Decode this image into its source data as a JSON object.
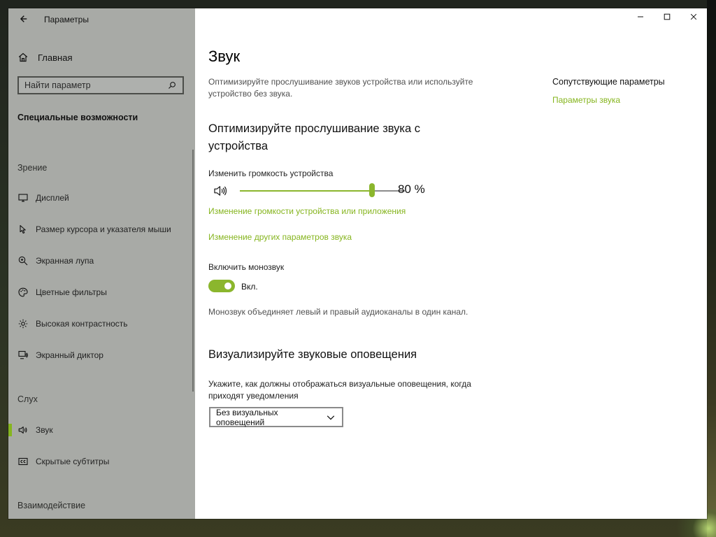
{
  "window": {
    "app_title": "Параметры",
    "controls": {
      "minimize_icon": "minimize-icon",
      "maximize_icon": "maximize-icon",
      "close_icon": "close-icon"
    }
  },
  "sidebar": {
    "back_icon": "back-arrow-icon",
    "home": {
      "label": "Главная",
      "icon": "home-icon"
    },
    "search": {
      "placeholder": "Найти параметр",
      "icon": "search-icon"
    },
    "category_title": "Специальные возможности",
    "sections": {
      "vision": "Зрение",
      "hearing": "Слух",
      "interaction": "Взаимодействие"
    },
    "items": [
      {
        "label": "Дисплей",
        "icon": "monitor-icon"
      },
      {
        "label": "Размер курсора и указателя мыши",
        "icon": "cursor-icon"
      },
      {
        "label": "Экранная лупа",
        "icon": "magnifier-icon"
      },
      {
        "label": "Цветные фильтры",
        "icon": "palette-icon"
      },
      {
        "label": "Высокая контрастность",
        "icon": "high-contrast-icon"
      },
      {
        "label": "Экранный диктор",
        "icon": "narrator-icon"
      },
      {
        "label": "Звук",
        "icon": "speaker-icon"
      },
      {
        "label": "Скрытые субтитры",
        "icon": "closed-captions-icon"
      }
    ],
    "accent_color": "#86b51f",
    "background_color": "#a8aaa6"
  },
  "main": {
    "title": "Звук",
    "description": "Оптимизируйте прослушивание звуков устройства или используйте устройство без звука.",
    "section_optimize": {
      "heading": "Оптимизируйте прослушивание звука с устройства",
      "volume_label": "Изменить громкость устройства",
      "volume": {
        "value": 80,
        "display": "80 %",
        "icon": "speaker-icon"
      },
      "link_app_volume": "Изменение громкости устройства или приложения",
      "link_other_settings": "Изменение других параметров звука",
      "mono_label": "Включить монозвук",
      "mono_toggle": {
        "state_label": "Вкл.",
        "on": true
      },
      "mono_description": "Монозвук объединяет левый и правый аудиоканалы в один канал."
    },
    "section_visual": {
      "heading": "Визуализируйте звуковые оповещения",
      "description": "Укажите, как должны отображаться визуальные оповещения, когда приходят уведомления",
      "dropdown": {
        "selected": "Без визуальных оповещений",
        "icon": "chevron-down-icon"
      }
    },
    "related": {
      "title": "Сопутствующие параметры",
      "links": [
        {
          "label": "Параметры звука"
        }
      ]
    }
  },
  "colors": {
    "accent": "#86b51f",
    "link": "#86b51f"
  }
}
